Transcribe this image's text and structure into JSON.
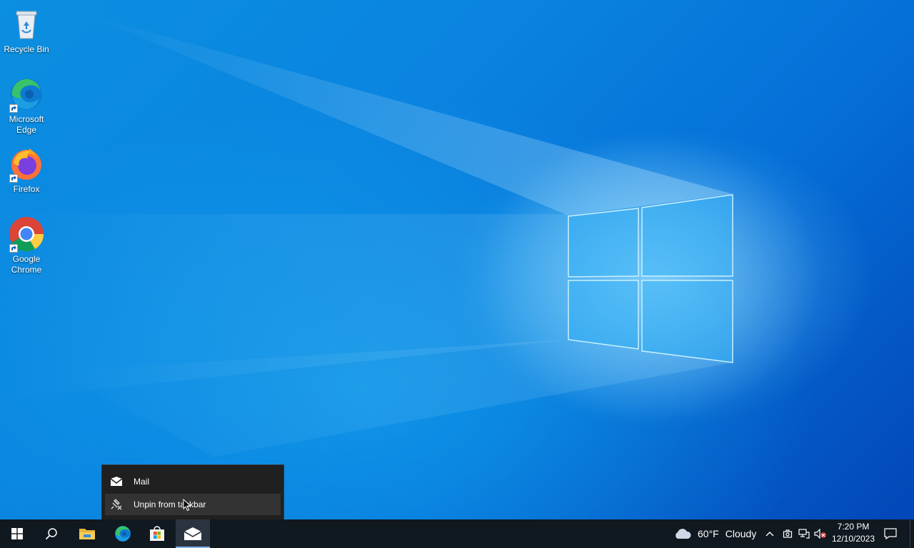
{
  "desktop": {
    "icons": [
      {
        "label": "Recycle Bin",
        "icon": "recycle-bin-icon"
      },
      {
        "label": "Microsoft Edge",
        "icon": "edge-icon"
      },
      {
        "label": "Firefox",
        "icon": "firefox-icon"
      },
      {
        "label": "Google Chrome",
        "icon": "chrome-icon"
      }
    ]
  },
  "jumplist": {
    "app_title": "Mail",
    "unpin_label": "Unpin from taskbar"
  },
  "taskbar": {
    "pinned": [
      "start-icon",
      "search-icon",
      "file-explorer-icon",
      "edge-icon",
      "microsoft-store-icon",
      "mail-icon"
    ],
    "weather": {
      "temp": "60°F",
      "condition": "Cloudy"
    },
    "clock": {
      "time": "7:20 PM",
      "date": "12/10/2023"
    }
  },
  "colors": {
    "taskbar_bg": "#101820",
    "jumplist_bg": "#202020",
    "accent": "#7fb5e6"
  }
}
